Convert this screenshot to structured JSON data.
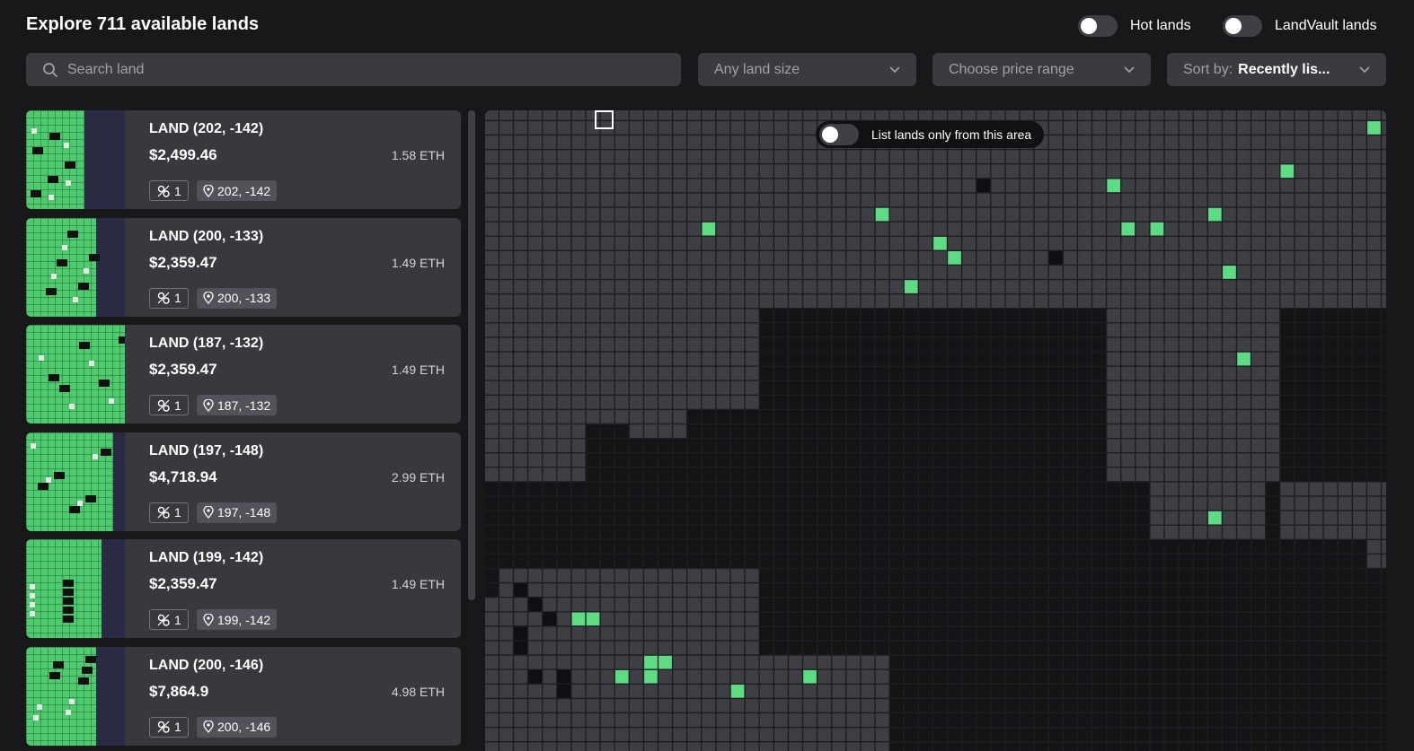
{
  "header": {
    "title": "Explore 711 available lands",
    "toggles": [
      {
        "label": "Hot lands",
        "on": false
      },
      {
        "label": "LandVault lands",
        "on": false
      }
    ]
  },
  "filters": {
    "search_placeholder": "Search land",
    "land_size": "Any land size",
    "price_range": "Choose price range",
    "sort_label": "Sort by:",
    "sort_value": "Recently lis..."
  },
  "lands": [
    {
      "title": "LAND (202, -142)",
      "price": "$2,499.46",
      "eth": "1.58 ETH",
      "count": "1",
      "coords": "202, -142",
      "green_w": 65
    },
    {
      "title": "LAND (200, -133)",
      "price": "$2,359.47",
      "eth": "1.49 ETH",
      "count": "1",
      "coords": "200, -133",
      "green_w": 78
    },
    {
      "title": "LAND (187, -132)",
      "price": "$2,359.47",
      "eth": "1.49 ETH",
      "count": "1",
      "coords": "187, -132",
      "green_w": 110
    },
    {
      "title": "LAND (197, -148)",
      "price": "$4,718.94",
      "eth": "2.99 ETH",
      "count": "1",
      "coords": "197, -148",
      "green_w": 97
    },
    {
      "title": "LAND (199, -142)",
      "price": "$2,359.47",
      "eth": "1.49 ETH",
      "count": "1",
      "coords": "199, -142",
      "green_w": 84
    },
    {
      "title": "LAND (200, -146)",
      "price": "$7,864.9",
      "eth": "4.98 ETH",
      "count": "1",
      "coords": "200, -146",
      "green_w": 78
    }
  ],
  "map": {
    "toggle_label": "List lands only from this area",
    "colors": {
      "parcel": "#3e3e45",
      "dark": "#0f0f12",
      "listed": "#5ddc83",
      "bg": "#1e1e22"
    }
  }
}
